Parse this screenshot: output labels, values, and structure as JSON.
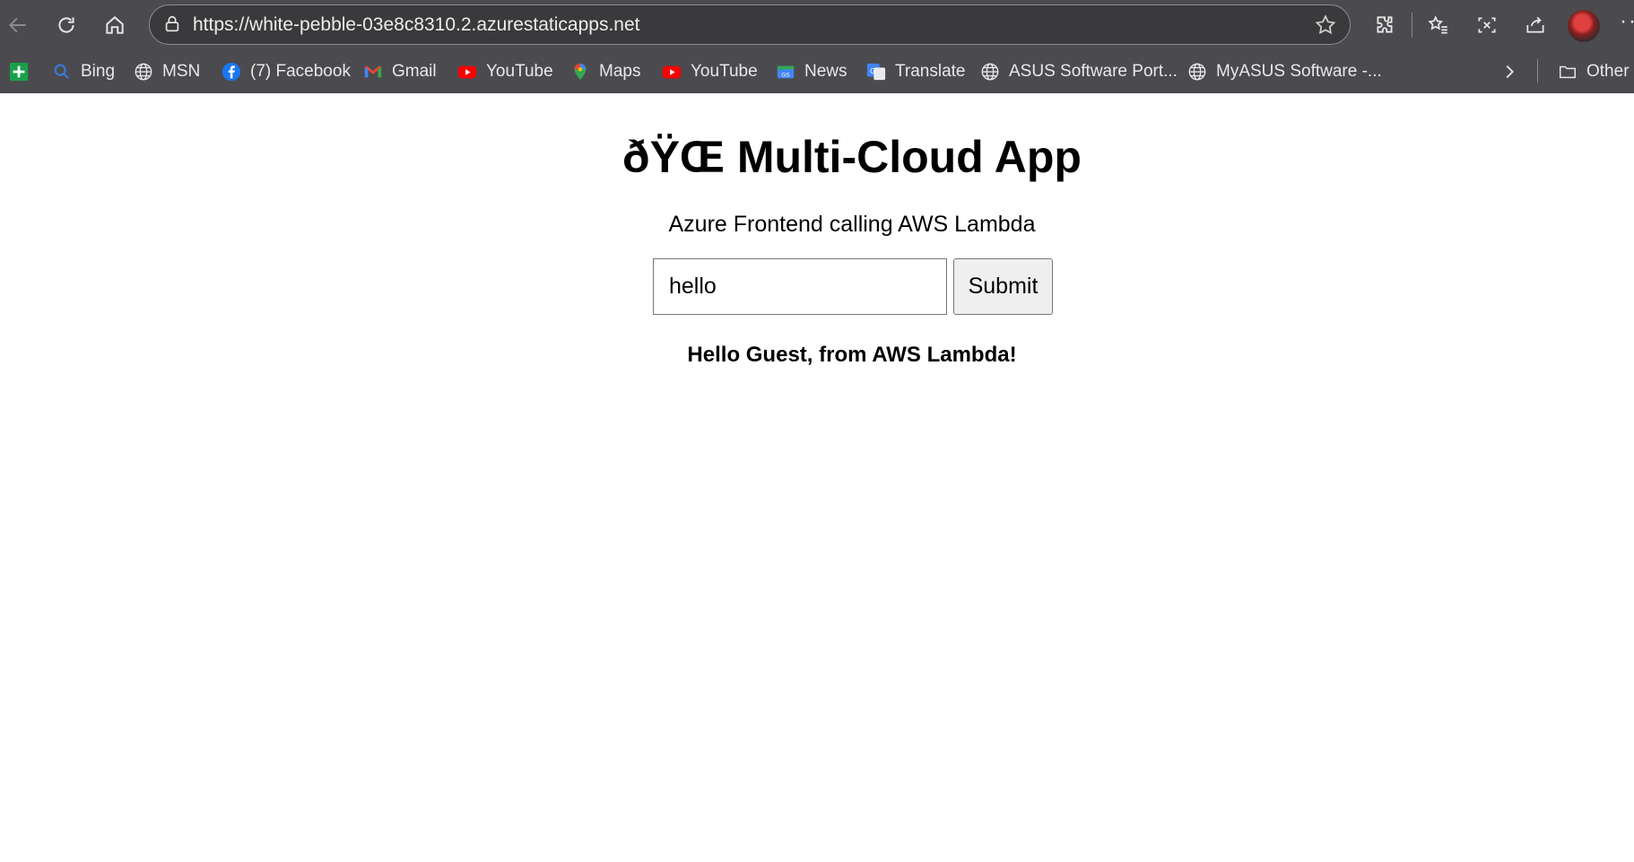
{
  "browser": {
    "url": "https://white-pebble-03e8c8310.2.azurestaticapps.net",
    "bookmarks": [
      {
        "label": "",
        "icon": "green-plus-icon"
      },
      {
        "label": "Bing",
        "icon": "bing-search-icon"
      },
      {
        "label": "MSN",
        "icon": "globe-icon"
      },
      {
        "label": "(7) Facebook",
        "icon": "facebook-icon"
      },
      {
        "label": "Gmail",
        "icon": "gmail-icon"
      },
      {
        "label": "YouTube",
        "icon": "youtube-icon"
      },
      {
        "label": "Maps",
        "icon": "maps-pin-icon"
      },
      {
        "label": "YouTube",
        "icon": "youtube-icon"
      },
      {
        "label": "News",
        "icon": "news-icon"
      },
      {
        "label": "Translate",
        "icon": "translate-icon"
      },
      {
        "label": "ASUS Software Port...",
        "icon": "globe-icon"
      },
      {
        "label": "MyASUS Software -...",
        "icon": "globe-icon"
      }
    ],
    "other_bookmarks_label": "Other"
  },
  "page": {
    "title": "ðŸŒ‍ Multi-Cloud App",
    "subtitle": "Azure Frontend calling AWS Lambda",
    "input_value": "hello",
    "submit_label": "Submit",
    "result_text": "Hello Guest, from AWS Lambda!"
  },
  "colors": {
    "chrome_bg": "#4b4b4f",
    "addressbar_bg": "#3a3a3c",
    "page_bg": "#ffffff"
  }
}
